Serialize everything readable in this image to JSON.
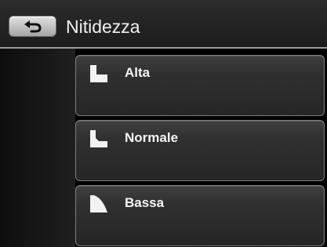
{
  "header": {
    "title": "Nitidezza",
    "back_icon": "back-arrow-icon"
  },
  "menu": {
    "items": [
      {
        "label": "Alta",
        "icon": "sharpness-high-icon"
      },
      {
        "label": "Normale",
        "icon": "sharpness-normal-icon"
      },
      {
        "label": "Bassa",
        "icon": "sharpness-low-icon"
      }
    ]
  }
}
